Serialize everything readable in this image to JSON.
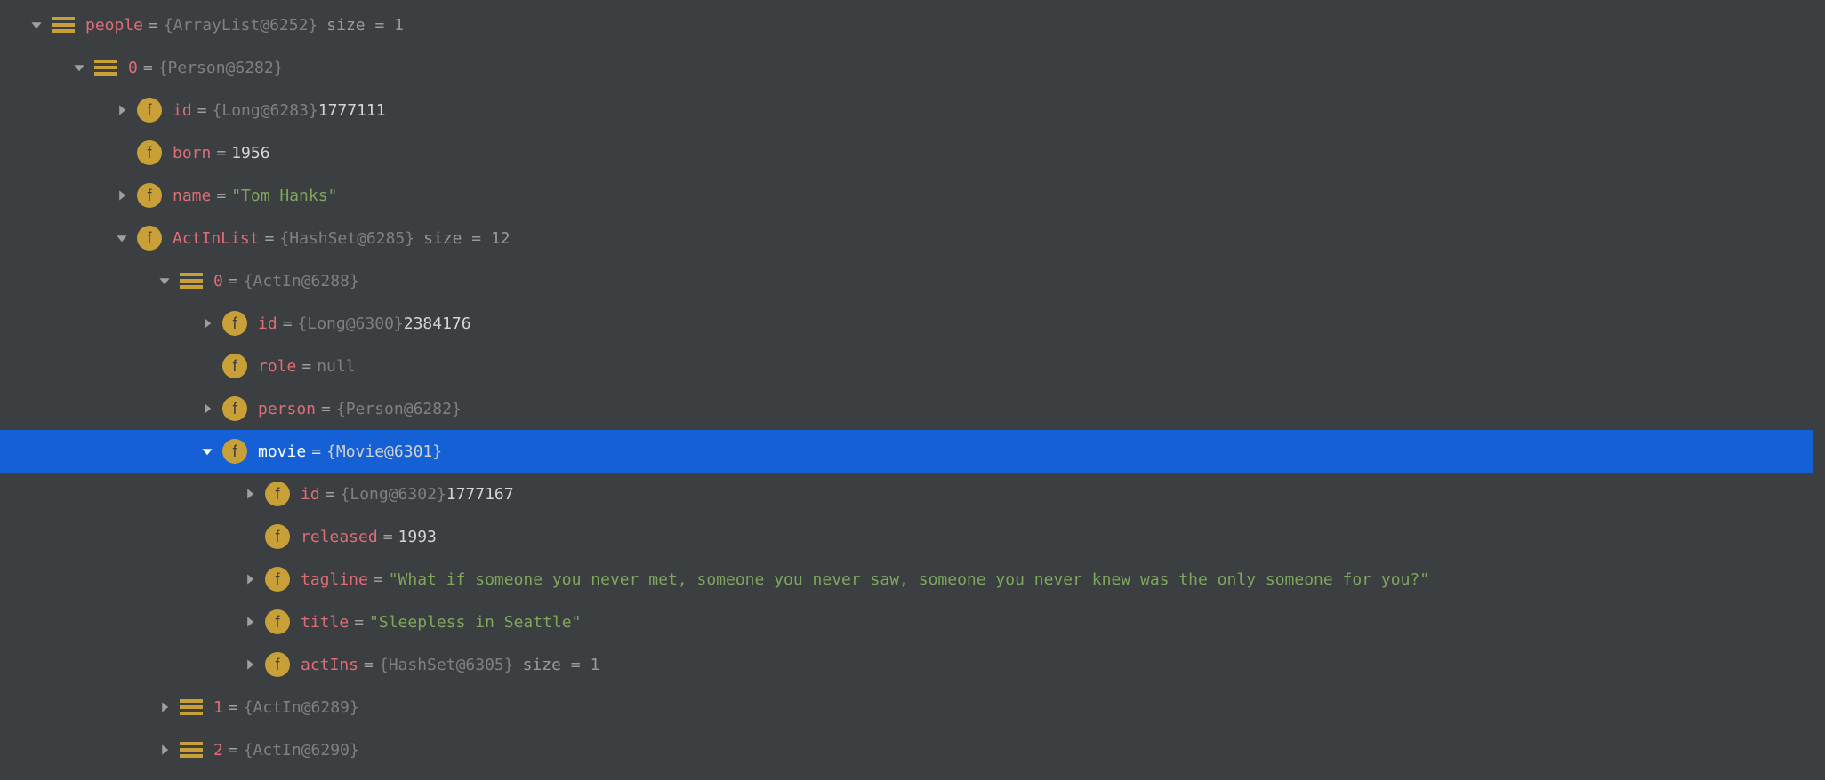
{
  "rows": [
    {
      "indent": 0,
      "arrow": "down",
      "icon": "list",
      "name": "people",
      "eq": "=",
      "objref": "{ArrayList@6252}",
      "sizetext": "size = 1",
      "selected": false
    },
    {
      "indent": 1,
      "arrow": "down",
      "icon": "list",
      "name": "0",
      "eq": "=",
      "objref": "{Person@6282}",
      "selected": false
    },
    {
      "indent": 2,
      "arrow": "right",
      "icon": "field",
      "name": "id",
      "eq": "=",
      "objref": "{Long@6283}",
      "plain": " 1777111",
      "selected": false
    },
    {
      "indent": 2,
      "arrow": "blank",
      "icon": "field",
      "name": "born",
      "eq": "=",
      "plain": " 1956",
      "selected": false
    },
    {
      "indent": 2,
      "arrow": "right",
      "icon": "field",
      "name": "name",
      "eq": "=",
      "str": " \"Tom Hanks\"",
      "selected": false
    },
    {
      "indent": 2,
      "arrow": "down",
      "icon": "field",
      "name": "ActInList",
      "eq": "=",
      "objref": "{HashSet@6285}",
      "sizetext": "size = 12",
      "selected": false
    },
    {
      "indent": 3,
      "arrow": "down",
      "icon": "list",
      "name": "0",
      "eq": "=",
      "objref": "{ActIn@6288}",
      "selected": false
    },
    {
      "indent": 4,
      "arrow": "right",
      "icon": "field",
      "name": "id",
      "eq": "=",
      "objref": "{Long@6300}",
      "plain": " 2384176",
      "selected": false
    },
    {
      "indent": 4,
      "arrow": "blank",
      "icon": "field",
      "name": "role",
      "eq": "=",
      "null": " null",
      "selected": false
    },
    {
      "indent": 4,
      "arrow": "right",
      "icon": "field",
      "name": "person",
      "eq": "=",
      "objref": "{Person@6282}",
      "selected": false
    },
    {
      "indent": 4,
      "arrow": "down",
      "icon": "field",
      "name": "movie",
      "eq": "=",
      "objref": "{Movie@6301}",
      "selected": true
    },
    {
      "indent": 5,
      "arrow": "right",
      "icon": "field",
      "name": "id",
      "eq": "=",
      "objref": "{Long@6302}",
      "plain": " 1777167",
      "selected": false
    },
    {
      "indent": 5,
      "arrow": "blank",
      "icon": "field",
      "name": "released",
      "eq": "=",
      "plain": " 1993",
      "selected": false
    },
    {
      "indent": 5,
      "arrow": "right",
      "icon": "field",
      "name": "tagline",
      "eq": "=",
      "str": " \"What if someone you never met, someone you never saw, someone you never knew was the only someone for you?\"",
      "selected": false
    },
    {
      "indent": 5,
      "arrow": "right",
      "icon": "field",
      "name": "title",
      "eq": "=",
      "str": " \"Sleepless in Seattle\"",
      "selected": false
    },
    {
      "indent": 5,
      "arrow": "right",
      "icon": "field",
      "name": "actIns",
      "eq": "=",
      "objref": "{HashSet@6305}",
      "sizetext": "size = 1",
      "selected": false
    },
    {
      "indent": 3,
      "arrow": "right",
      "icon": "list",
      "name": "1",
      "eq": "=",
      "objref": "{ActIn@6289}",
      "selected": false
    },
    {
      "indent": 3,
      "arrow": "right",
      "icon": "list",
      "name": "2",
      "eq": "=",
      "objref": "{ActIn@6290}",
      "selected": false
    }
  ],
  "labels": {
    "fieldGlyph": "f"
  }
}
